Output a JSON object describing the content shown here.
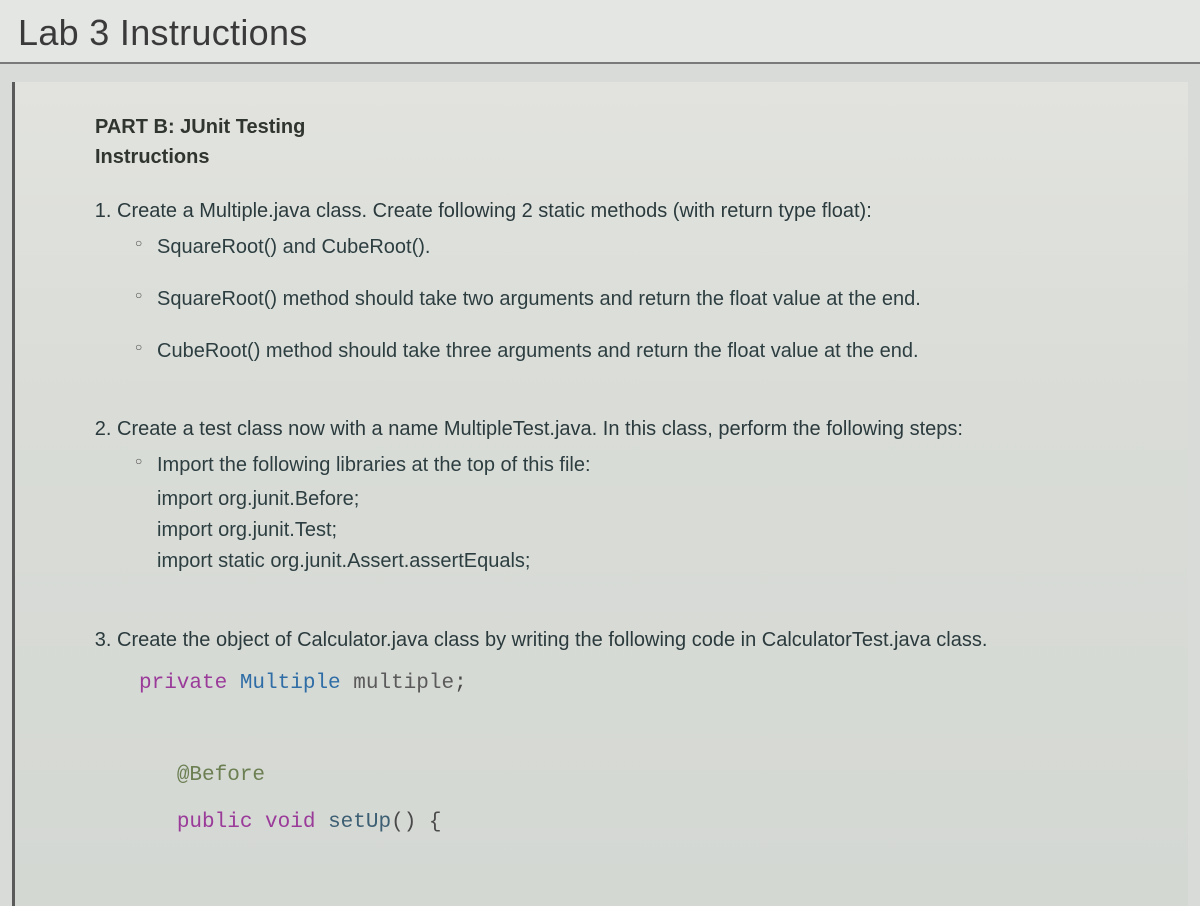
{
  "title": "Lab 3 Instructions",
  "partLabel": "PART B: JUnit Testing",
  "instructionsLabel": "Instructions",
  "steps": [
    {
      "text": "Create a Multiple.java class. Create following 2 static methods (with return type float):",
      "subs": [
        {
          "text": "SquareRoot() and CubeRoot()."
        },
        {
          "text": "SquareRoot() method should take two arguments and return the float value at the end."
        },
        {
          "text": "CubeRoot() method should take three arguments and return the float value at the end."
        }
      ]
    },
    {
      "text": "Create a test class now with a name MultipleTest.java. In this class, perform the following steps:",
      "subs": [
        {
          "text": "Import the following libraries at the top of this file:",
          "imports": [
            "import org.junit.Before;",
            "import org.junit.Test;",
            "import static org.junit.Assert.assertEquals;"
          ]
        }
      ]
    },
    {
      "text": "Create the object of Calculator.java class by writing the following code in CalculatorTest.java class.",
      "code": {
        "line1": {
          "private": "private",
          "type": "Multiple",
          "var": "multiple",
          "end": ";"
        },
        "line2": {
          "ann": "@Before"
        },
        "line3": {
          "public": "public",
          "void": "void",
          "method": "setUp",
          "paren": "()",
          "brace": " {"
        }
      }
    }
  ]
}
